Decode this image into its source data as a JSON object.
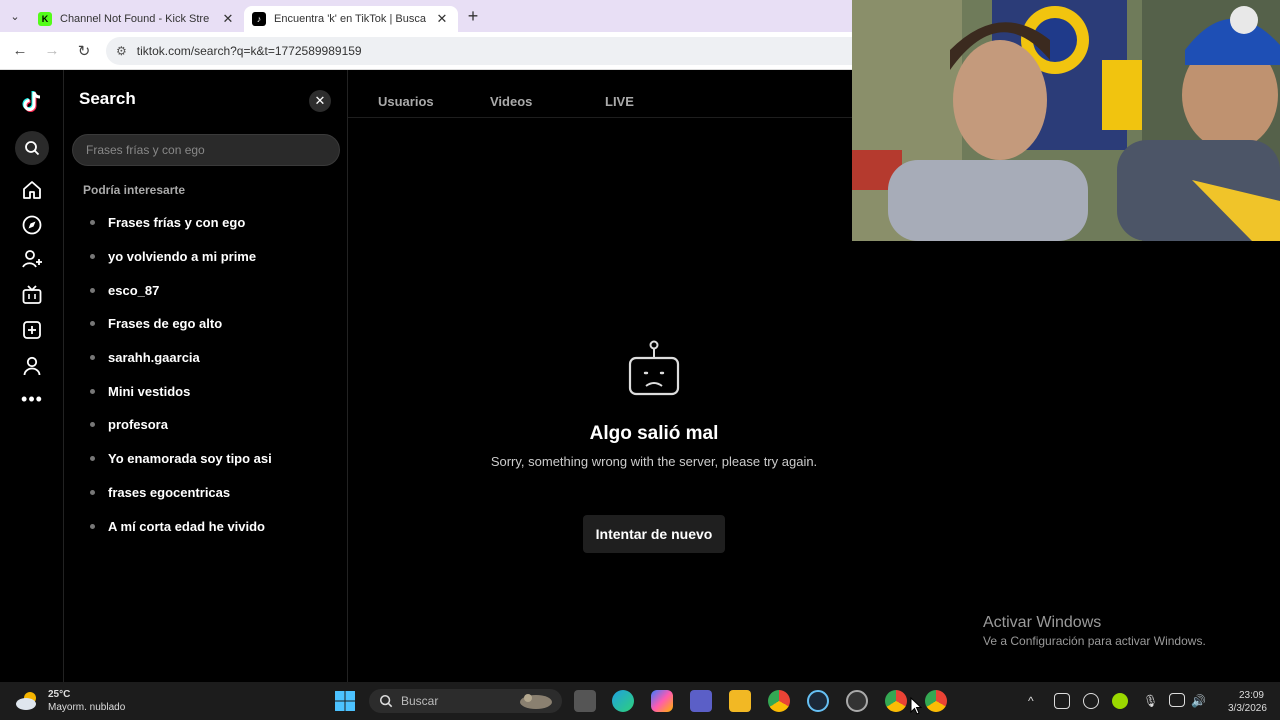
{
  "browser": {
    "tabs": [
      {
        "title": "Channel Not Found - Kick Stre",
        "active": false
      },
      {
        "title": "Encuentra 'k' en TikTok | Busca",
        "active": true
      }
    ],
    "url": "tiktok.com/search?q=k&t=1772589989159"
  },
  "sidebar": {
    "icons": [
      "tiktok-logo",
      "search-icon",
      "home-icon",
      "explore-icon",
      "following-icon",
      "live-icon",
      "upload-icon",
      "profile-icon",
      "more-icon"
    ]
  },
  "search_panel": {
    "title": "Search",
    "placeholder": "Frases frías y con ego",
    "subtitle": "Podría interesarte",
    "suggestions": [
      "Frases frías y con ego",
      "yo volviendo a mi prime",
      "esco_87",
      "Frases de ego alto",
      "sarahh.gaarcia",
      "Mini vestidos",
      "profesora",
      "Yo enamorada soy tipo asi",
      "frases egocentricas",
      "A mí corta edad he vivido"
    ]
  },
  "result_tabs": [
    "Usuarios",
    "Videos",
    "LIVE"
  ],
  "error": {
    "title": "Algo salió mal",
    "message": "Sorry, something wrong with the server, please try again.",
    "retry_label": "Intentar de nuevo"
  },
  "windows_watermark": {
    "line1": "Activar Windows",
    "line2": "Ve a Configuración para activar Windows."
  },
  "taskbar": {
    "temperature": "25°C",
    "condition": "Mayorm. nublado",
    "search_placeholder": "Buscar",
    "time": "23:09",
    "date": "3/3/2026"
  },
  "colors": {
    "accent": "#fe2c55",
    "tabbar_bg": "#e8dff5",
    "page_bg": "#000000"
  }
}
